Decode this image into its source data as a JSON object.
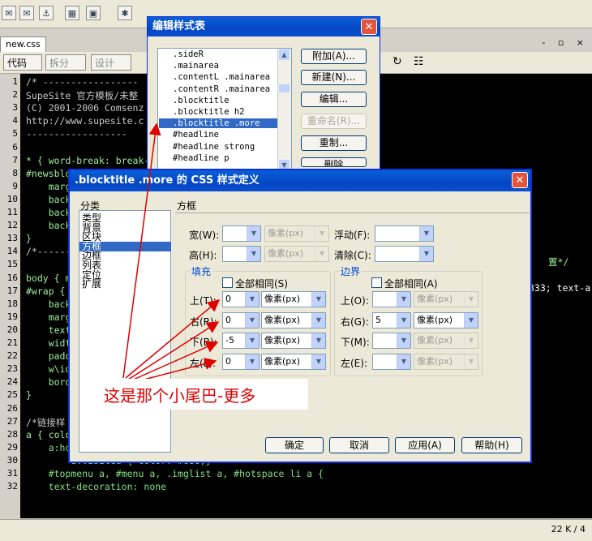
{
  "ide": {
    "file_tab": "new.css",
    "view_buttons": [
      "代码",
      "拆分",
      "设计"
    ],
    "line_numbers": [
      "1",
      "2",
      "3",
      "4",
      "5",
      "6",
      "7",
      "8",
      "9",
      "10",
      "11",
      "12",
      "13",
      "14",
      "15",
      "16",
      "17",
      "18",
      "19",
      "20",
      "21",
      "22",
      "23",
      "24",
      "25",
      "26",
      "27",
      "28",
      "29",
      "30",
      "31",
      "32"
    ],
    "code_lines": [
      "/* -----------------",
      "SupeSite 官方模板/未整",
      "(C) 2001-2006 Comsenz",
      "http://www.supesite.c",
      "------------------",
      "",
      "* { word-break: break-",
      "#newsblo",
      "    marg",
      "    back",
      "    back",
      "    back",
      "}",
      "/*------",
      "",
      "body { m",
      "#wrap {",
      "    back",
      "    marg",
      "    text",
      "    widtl",
      "    padd",
      "    w\\id",
      "    bord",
      "}",
      "",
      "/*链接样",
      "a { colo",
      "    a:hover { text-decoration: underline; color: #000098; }",
      "        a:visited { color: #666;}",
      "    #topmenu a, #menu a, .imglist a, #hotspace li a {",
      "    text-decoration: none"
    ],
    "right_code_fragments": [
      "置*/",
      "333; text-a"
    ],
    "status": "22 K / 4"
  },
  "style_dialog": {
    "title": "编辑样式表",
    "list_items": [
      ".sideR",
      ".mainarea",
      ".contentL .mainarea",
      ".contentR .mainarea",
      ".blocktitle",
      ".blocktitle h2",
      ".blocktitle .more",
      "#headline",
      "#headline strong",
      "#headline p"
    ],
    "selected_index": 6,
    "buttons": [
      "附加(A)...",
      "新建(N)...",
      "编辑...",
      "重命名(R)...",
      "重制...",
      "删除"
    ],
    "disabled_buttons": [
      3
    ]
  },
  "css_dialog": {
    "title": ".blocktitle .more 的 CSS 样式定义",
    "category_label": "分类",
    "categories": [
      "类型",
      "背景",
      "区块",
      "方框",
      "边框",
      "列表",
      "定位",
      "扩展"
    ],
    "selected_category": 3,
    "panel_title": "方框",
    "width_label": "宽(W):",
    "height_label": "高(H):",
    "float_label": "浮动(F):",
    "clear_label": "清除(C):",
    "unit_placeholder": "像素(px)",
    "padding": {
      "label": "填充",
      "same_all": "全部相同(S)",
      "rows": [
        {
          "label": "上(T):",
          "value": "0",
          "unit": "像素(px)"
        },
        {
          "label": "右(R):",
          "value": "0",
          "unit": "像素(px)"
        },
        {
          "label": "下(B):",
          "value": "-5",
          "unit": "像素(px)"
        },
        {
          "label": "左(L):",
          "value": "0",
          "unit": "像素(px)"
        }
      ]
    },
    "margin": {
      "label": "边界",
      "same_all": "全部相同(A)",
      "rows": [
        {
          "label": "上(O):",
          "value": "",
          "unit": "像素(px)"
        },
        {
          "label": "右(G):",
          "value": "5",
          "unit": "像素(px)"
        },
        {
          "label": "下(M):",
          "value": "",
          "unit": "像素(px)"
        },
        {
          "label": "左(E):",
          "value": "",
          "unit": "像素(px)"
        }
      ]
    },
    "buttons": {
      "ok": "确定",
      "cancel": "取消",
      "apply": "应用(A)",
      "help": "帮助(H)"
    }
  },
  "annotation": {
    "text": "这是那个小尾巴-更多",
    "color": "#e00000"
  }
}
